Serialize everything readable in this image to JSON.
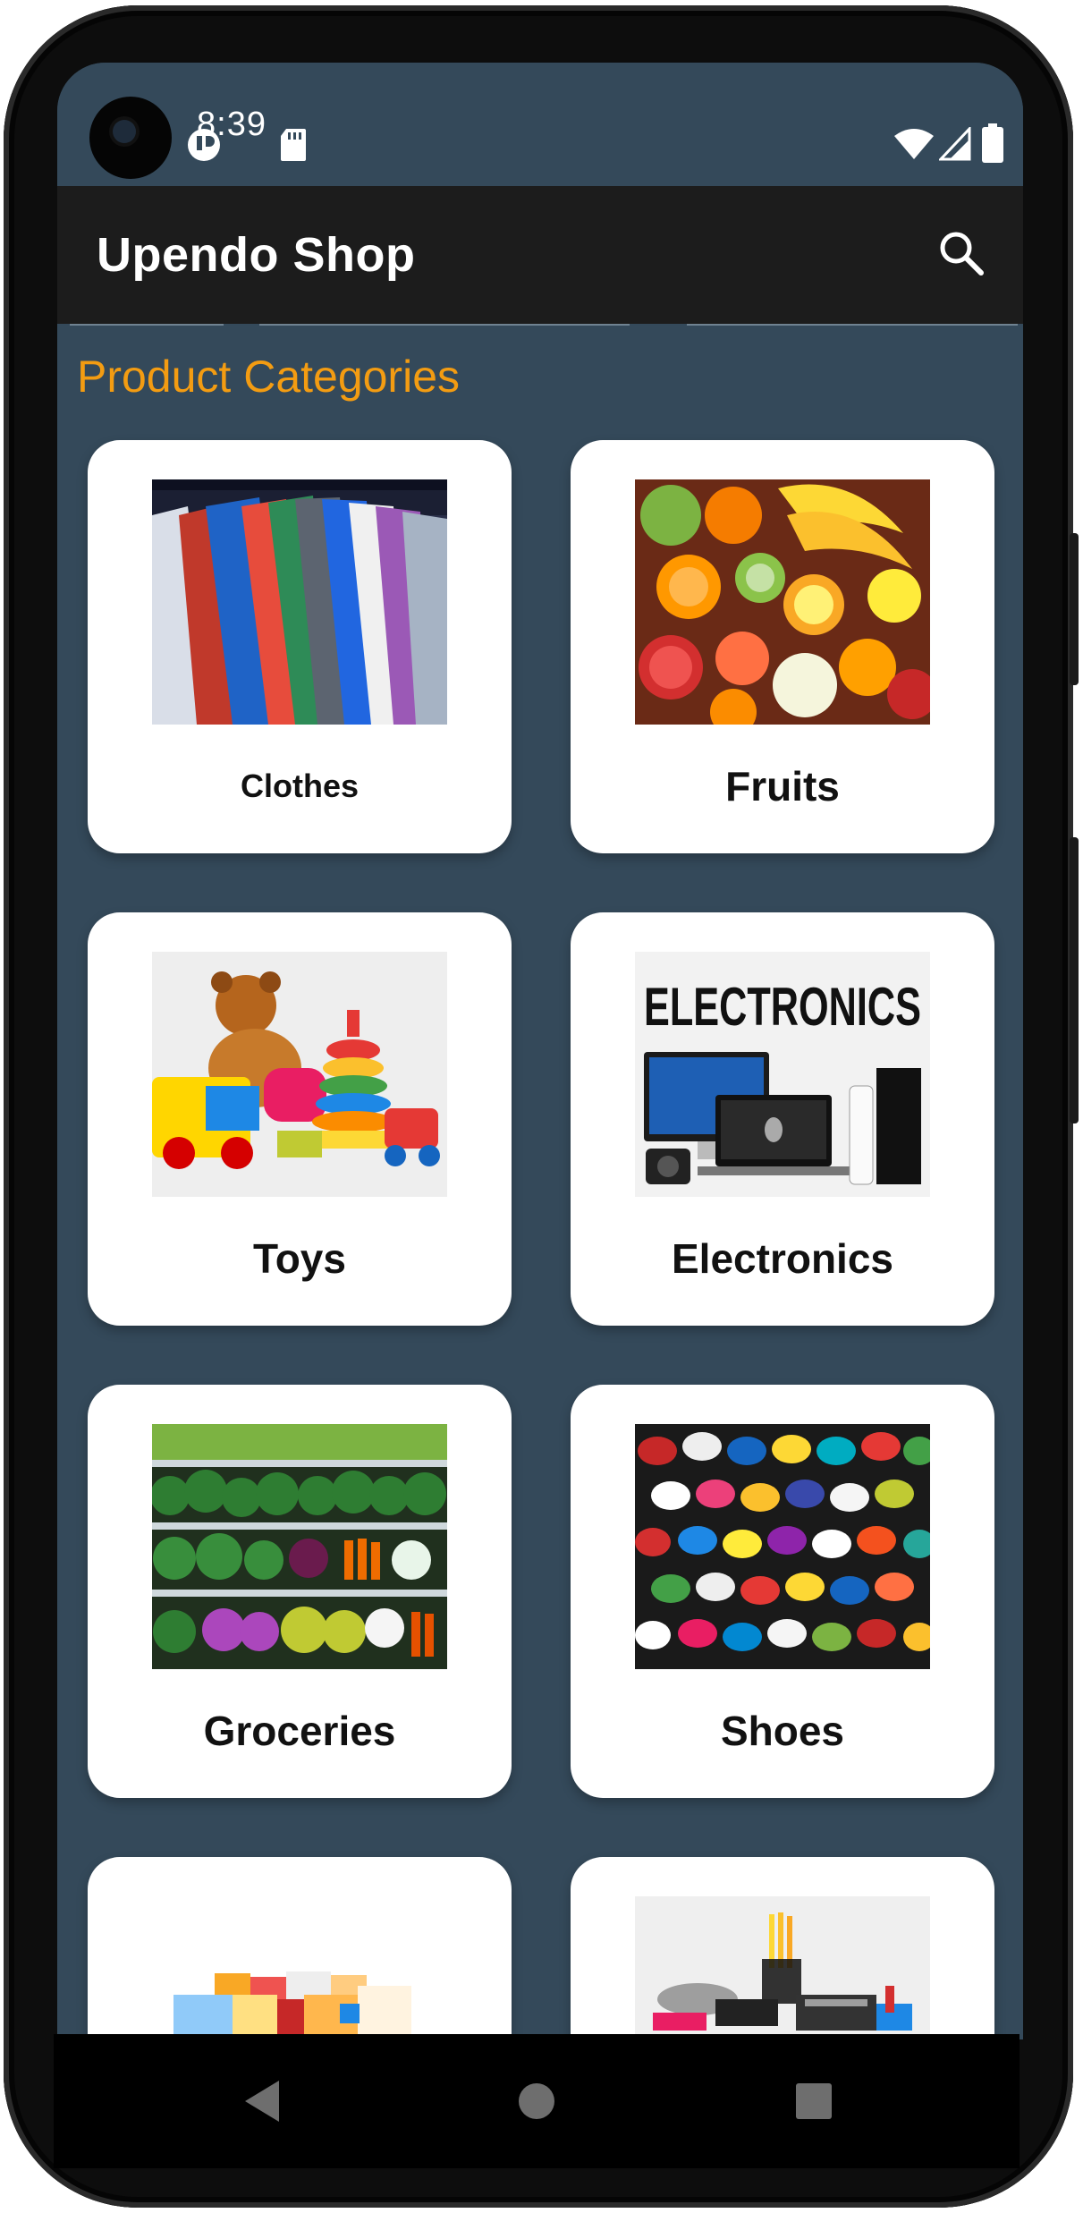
{
  "status_bar": {
    "time": "8:39",
    "icons": [
      "camera-cutout",
      "vpn-icon",
      "sd-card-icon",
      "wifi-icon",
      "cell-signal-icon",
      "battery-icon"
    ]
  },
  "app_bar": {
    "title": "Upendo Shop",
    "search_icon": "search-icon"
  },
  "main": {
    "section_title": "Product Categories",
    "categories": [
      {
        "label": "Clothes"
      },
      {
        "label": "Fruits"
      },
      {
        "label": "Toys"
      },
      {
        "label": "Electronics",
        "banner_text": "ELECTRONICS"
      },
      {
        "label": "Groceries"
      },
      {
        "label": "Shoes"
      },
      {
        "label": ""
      },
      {
        "label": ""
      }
    ]
  },
  "navigation": {
    "back_icon": "back-triangle-icon",
    "home_icon": "home-circle-icon",
    "recents_icon": "recents-square-icon"
  },
  "colors": {
    "background": "#34495a",
    "app_bar": "#1c1c1c",
    "accent": "#f39c12",
    "card": "#ffffff"
  }
}
